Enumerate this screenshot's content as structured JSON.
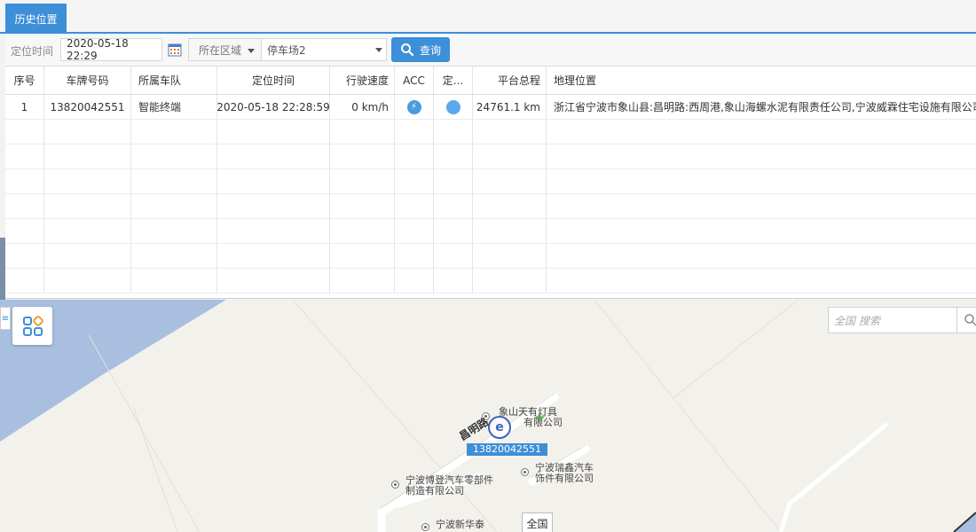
{
  "tab": {
    "label": "历史位置"
  },
  "toolbar": {
    "time_label": "定位时间",
    "time_value": "2020-05-18 22:29",
    "area_label": "所在区域",
    "area_value": "停车场2",
    "query_label": "查询"
  },
  "table": {
    "headers": [
      "序号",
      "车牌号码",
      "所属车队",
      "定位时间",
      "行驶速度",
      "ACC",
      "定...",
      "平台总程",
      "地理位置"
    ],
    "rows": [
      {
        "index": "1",
        "plate": "13820042551",
        "fleet": "智能终端",
        "time": "2020-05-18 22:28:59",
        "speed": "0 km/h",
        "acc_icon": "lightning-icon",
        "pos_icon": "dot-icon",
        "mileage": "24761.1 km",
        "address": "浙江省宁波市象山县:昌明路:西周港,象山海螺水泥有限责任公司,宁波威霖住宅设施有限公司"
      }
    ]
  },
  "map": {
    "search_placeholder": "全国 搜索",
    "vehicle_label": "13820042551",
    "road_name": "昌明路",
    "region_button": "全国",
    "pois": [
      {
        "line1": "象山天有灯具",
        "line2": "有限公司"
      },
      {
        "line1": "宁波博登汽车零部件",
        "line2": "制造有限公司"
      },
      {
        "line1": "宁波瑞鑫汽车",
        "line2": "饰件有限公司"
      },
      {
        "line1": "宁波新华泰",
        "line2": ""
      }
    ],
    "colors": {
      "water": "#a9bfe0",
      "land": "#f3f1ec",
      "road": "#ffffff",
      "accent": "#3d8fd8"
    }
  }
}
